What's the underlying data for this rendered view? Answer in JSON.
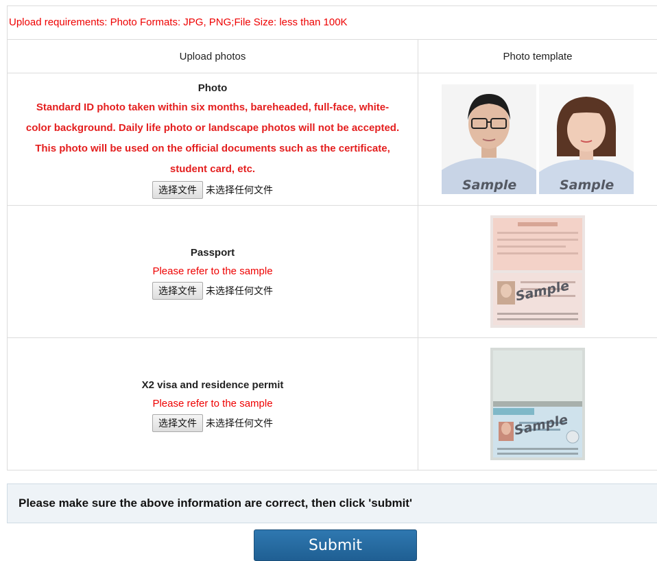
{
  "requirements": "Upload requirements: Photo Formats: JPG, PNG;File Size: less than 100K",
  "table": {
    "col_upload": "Upload photos",
    "col_template": "Photo template"
  },
  "rows": [
    {
      "title": "Photo",
      "desc_lines": [
        "Standard ID photo taken within six months, bareheaded, full-face, white-",
        "color background. Daily life photo or landscape photos will not be accepted.",
        "This photo will be used on the official documents such as the certificate,",
        "student card, etc."
      ],
      "button": "选择文件",
      "status": "未选择任何文件",
      "sample_text": "Sample"
    },
    {
      "title": "Passport",
      "note": "Please refer to the sample",
      "button": "选择文件",
      "status": "未选择任何文件",
      "sample_text": "Sample"
    },
    {
      "title": "X2 visa and residence permit",
      "note": "Please refer to the sample",
      "button": "选择文件",
      "status": "未选择任何文件",
      "sample_text": "Sample"
    }
  ],
  "notice": "Please make sure the above information are correct, then click 'submit'",
  "submit": "Submit",
  "colors": {
    "red": "#ee0000",
    "button_blue": "#1f5f93",
    "notice_bg": "#eef3f7"
  }
}
